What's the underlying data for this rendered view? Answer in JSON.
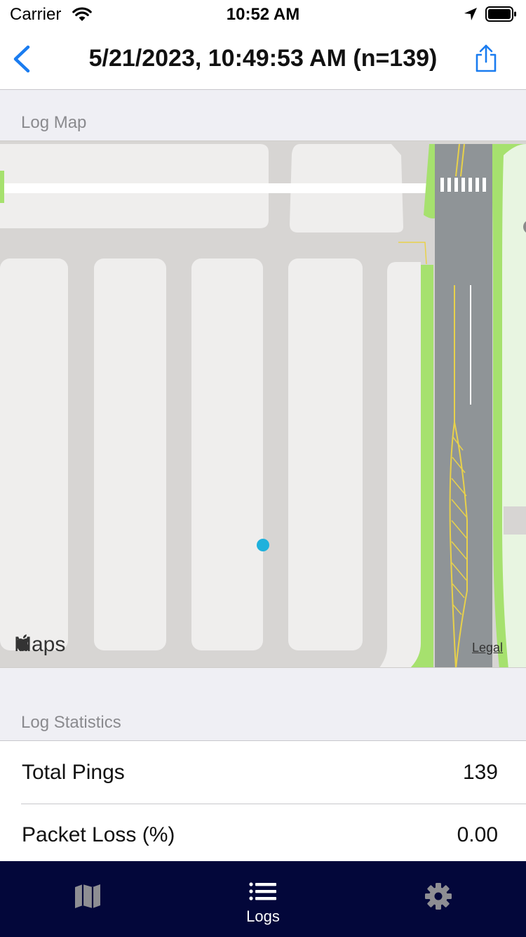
{
  "status_bar": {
    "carrier": "Carrier",
    "time": "10:52 AM"
  },
  "nav": {
    "title": "5/21/2023, 10:49:53 AM (n=139)",
    "back_icon": "chevron-left-icon",
    "share_icon": "share-icon"
  },
  "sections": {
    "map_header": "Log Map",
    "stats_header": "Log Statistics"
  },
  "map": {
    "logo_text": "Maps",
    "legal_text": "Legal",
    "dot_color": "#1fb1dc"
  },
  "stats": [
    {
      "label": "Total Pings",
      "value": "139"
    },
    {
      "label": "Packet Loss (%)",
      "value": "0.00"
    }
  ],
  "tabs": [
    {
      "id": "map",
      "icon": "map-icon",
      "label": ""
    },
    {
      "id": "logs",
      "icon": "list-icon",
      "label": "Logs",
      "selected": true
    },
    {
      "id": "settings",
      "icon": "gear-icon",
      "label": ""
    }
  ],
  "colors": {
    "accent": "#1a7cf0",
    "tab_bar_bg": "#03073a",
    "map_dot": "#1fb1dc"
  }
}
